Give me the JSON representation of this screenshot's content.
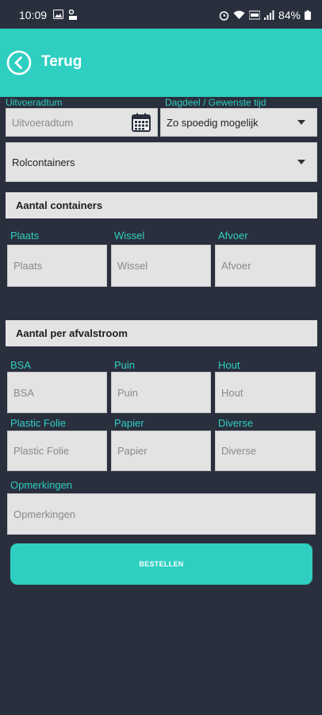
{
  "status_bar": {
    "time": "10:09",
    "battery": "84%"
  },
  "header": {
    "back_icon": "back-circle-icon",
    "title": "Terug"
  },
  "date_section": {
    "date_label": "Uitvoeradtum",
    "date_placeholder": "Uitvoeradtum",
    "daypart_label": "Dagdeel / Gewenste tijd",
    "daypart_value": "Zo spoedig mogelijk",
    "container_type_value": "Rolcontainers"
  },
  "containers": {
    "title": "Aantal containers",
    "fields": [
      {
        "label": "Plaats",
        "placeholder": "Plaats"
      },
      {
        "label": "Wissel",
        "placeholder": "Wissel"
      },
      {
        "label": "Afvoer",
        "placeholder": "Afvoer"
      }
    ]
  },
  "waste_streams": {
    "title": "Aantal per afvalstroom",
    "fields": [
      {
        "label": "BSA",
        "placeholder": "BSA"
      },
      {
        "label": "Puin",
        "placeholder": "Puin"
      },
      {
        "label": "Hout",
        "placeholder": "Hout"
      },
      {
        "label": "Plastic Folie",
        "placeholder": "Plastic Folie"
      },
      {
        "label": "Papier",
        "placeholder": "Papier"
      },
      {
        "label": "Diverse",
        "placeholder": "Diverse"
      }
    ]
  },
  "remarks": {
    "label": "Opmerkingen",
    "placeholder": "Opmerkingen"
  },
  "order_button": {
    "label": "BESTELLEN"
  },
  "colors": {
    "accent": "#2ecfc1",
    "background": "#2a2f3d",
    "field": "#e3e3e3"
  }
}
